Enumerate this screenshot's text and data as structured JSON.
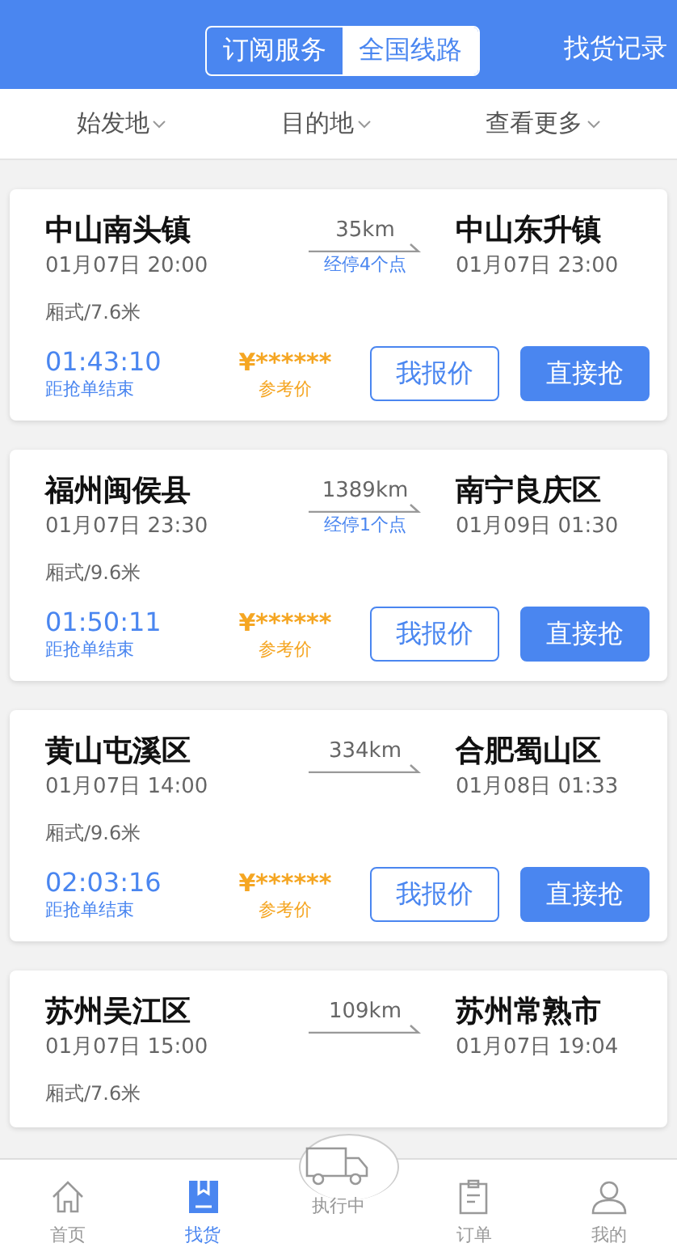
{
  "header": {
    "segments": [
      {
        "label": "订阅服务",
        "selected": false
      },
      {
        "label": "全国线路",
        "selected": true
      }
    ],
    "action": "找货记录"
  },
  "filters": [
    "始发地",
    "目的地",
    "查看更多"
  ],
  "orders": [
    {
      "origin": "中山南头镇",
      "origin_time": "01月07日 20:00",
      "distance": "35km",
      "stops": "经停4个点",
      "destination": "中山东升镇",
      "destination_time": "01月07日 23:00",
      "vehicle": "厢式/7.6米",
      "countdown": "01:43:10",
      "countdown_label": "距抢单结束",
      "price": "¥******",
      "price_label": "参考价",
      "quote_button": "我报价",
      "grab_button": "直接抢"
    },
    {
      "origin": "福州闽侯县",
      "origin_time": "01月07日 23:30",
      "distance": "1389km",
      "stops": "经停1个点",
      "destination": "南宁良庆区",
      "destination_time": "01月09日 01:30",
      "vehicle": "厢式/9.6米",
      "countdown": "01:50:11",
      "countdown_label": "距抢单结束",
      "price": "¥******",
      "price_label": "参考价",
      "quote_button": "我报价",
      "grab_button": "直接抢"
    },
    {
      "origin": "黄山屯溪区",
      "origin_time": "01月07日 14:00",
      "distance": "334km",
      "destination": "合肥蜀山区",
      "destination_time": "01月08日 01:33",
      "vehicle": "厢式/9.6米",
      "countdown": "02:03:16",
      "countdown_label": "距抢单结束",
      "price": "¥******",
      "price_label": "参考价",
      "quote_button": "我报价",
      "grab_button": "直接抢"
    },
    {
      "origin": "苏州吴江区",
      "origin_time": "01月07日 15:00",
      "distance": "109km",
      "destination": "苏州常熟市",
      "destination_time": "01月07日 19:04",
      "vehicle": "厢式/7.6米"
    }
  ],
  "tab_bar": [
    {
      "kind": "home",
      "label": "首页",
      "selected": false
    },
    {
      "kind": "cargo",
      "label": "找货",
      "selected": true
    },
    {
      "kind": "truck",
      "label": "执行中",
      "selected": false
    },
    {
      "kind": "order",
      "label": "订单",
      "selected": false
    },
    {
      "kind": "profile",
      "label": "我的",
      "selected": false
    }
  ]
}
